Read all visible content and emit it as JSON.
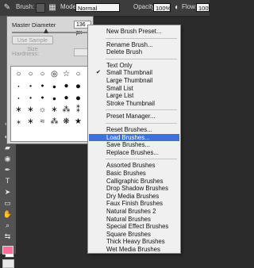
{
  "options_bar": {
    "brush_label": "Brush:",
    "mode_label": "Mode:",
    "mode_value": "Normal",
    "opacity_label": "Opacity:",
    "opacity_value": "100%",
    "flow_label": "Flow:",
    "flow_value": "100%"
  },
  "brush_picker": {
    "master_diameter_label": "Master Diameter",
    "master_diameter_value": "136 px",
    "use_sample_size_label": "Use Sample Size",
    "hardness_label": "Hardness:",
    "brush_glyphs": [
      "○",
      "○",
      "○",
      "◎",
      "☆",
      "○",
      "●",
      "●",
      "●",
      "●",
      "●",
      "●",
      "●",
      "●",
      "●",
      "●",
      "●",
      "●",
      "∗",
      "∗",
      "☼",
      "∗",
      "⁂",
      "⁑",
      "⁎",
      "∗",
      "≈",
      "⁂",
      "❋",
      "★"
    ]
  },
  "menu": {
    "groups": [
      [
        {
          "label": "New Brush Preset..."
        }
      ],
      [
        {
          "label": "Rename Brush..."
        },
        {
          "label": "Delete Brush"
        }
      ],
      [
        {
          "label": "Text Only"
        },
        {
          "label": "Small Thumbnail",
          "checked": true
        },
        {
          "label": "Large Thumbnail"
        },
        {
          "label": "Small List"
        },
        {
          "label": "Large List"
        },
        {
          "label": "Stroke Thumbnail"
        }
      ],
      [
        {
          "label": "Preset Manager..."
        }
      ],
      [
        {
          "label": "Reset Brushes..."
        },
        {
          "label": "Load Brushes...",
          "highlighted": true
        },
        {
          "label": "Save Brushes..."
        },
        {
          "label": "Replace Brushes..."
        }
      ],
      [
        {
          "label": "Assorted Brushes"
        },
        {
          "label": "Basic Brushes"
        },
        {
          "label": "Calligraphic Brushes"
        },
        {
          "label": "Drop Shadow Brushes"
        },
        {
          "label": "Dry Media Brushes"
        },
        {
          "label": "Faux Finish Brushes"
        },
        {
          "label": "Natural Brushes 2"
        },
        {
          "label": "Natural Brushes"
        },
        {
          "label": "Special Effect Brushes"
        },
        {
          "label": "Square Brushes"
        },
        {
          "label": "Thick Heavy Brushes"
        },
        {
          "label": "Wet Media Brushes"
        }
      ]
    ]
  },
  "colors": {
    "foreground_swatch": "#ff6b9a",
    "menu_highlight": "#3e72d6"
  }
}
